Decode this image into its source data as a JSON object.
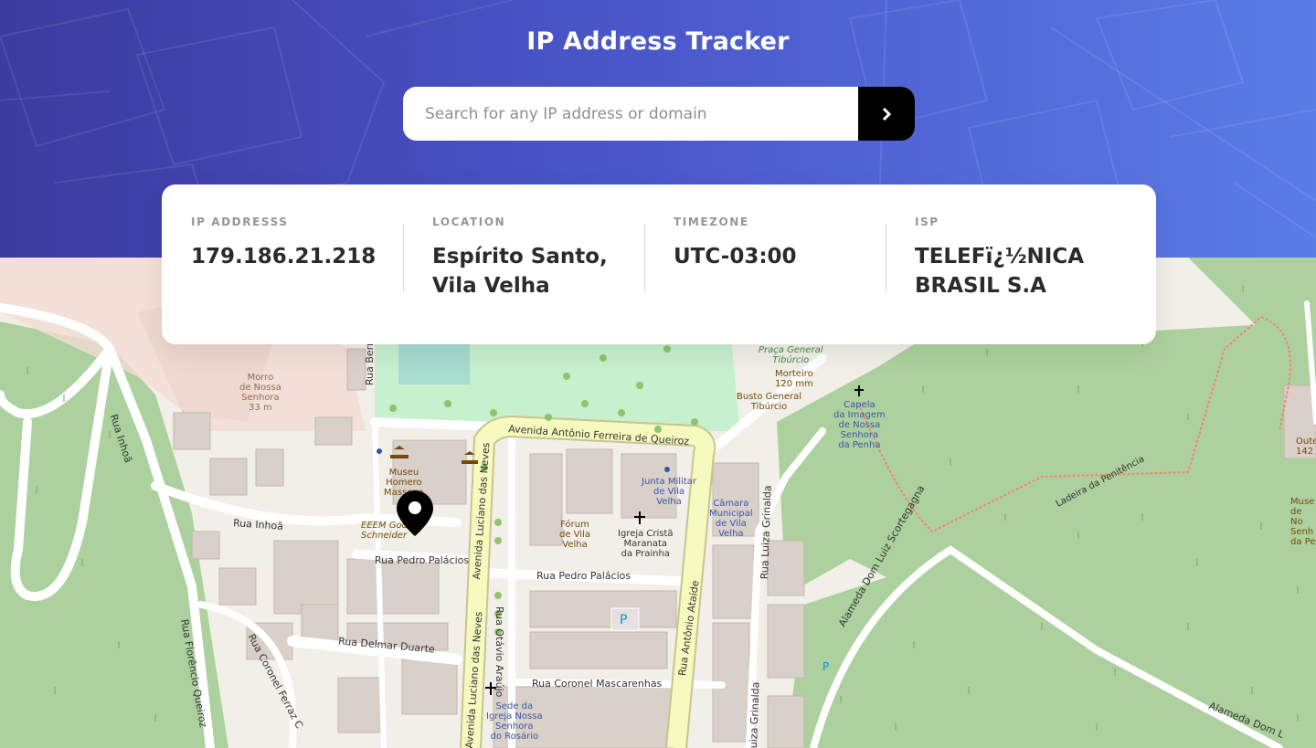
{
  "app": {
    "title": "IP Address Tracker"
  },
  "search": {
    "placeholder": "Search for any IP address or domain",
    "value": "",
    "submit_icon": "chevron-right-icon"
  },
  "info": {
    "ip": {
      "label": "IP ADDRESSS",
      "value": "179.186.21.218"
    },
    "location": {
      "label": "LOCATION",
      "value": "Espírito Santo, Vila Velha"
    },
    "timezone": {
      "label": "TIMEZONE",
      "value": "UTC-03:00"
    },
    "isp": {
      "label": "ISP",
      "value": "TELEFï¿½NICA BRASIL S.A"
    }
  },
  "map": {
    "marker_icon": "location-pin-icon",
    "labels": {
      "morro": "Morro\nde Nossa\nSenhora\n33 m",
      "rua_inhoa": "Rua Inhoã",
      "rua_inhoa_v": "Rua Inhoã",
      "rua_florencio": "Rua Florêncio Queiroz",
      "rua_coronel_ferraz": "Rua Coronel Ferraz C",
      "rua_delmar": "Rua Delmar Duarte",
      "rua_pedro1": "Rua Pedro Palácios",
      "rua_pedro2": "Rua Pedro Palácios",
      "av_luciano": "Avenida Luciano das Neves",
      "av_luciano2": "Avenida Luciano das Neves",
      "av_antonio": "Avenida Antônio Ferreira de Queiroz",
      "rua_ataide": "Rua Antônio Ataíde",
      "rua_otavio": "Rua Otávio Araújo",
      "rua_mascarenhas": "Rua Coronel Mascarenhas",
      "rua_grinalda": "Rua Luiza Grinalda",
      "rua_grinalda2": "uiza Grinalda",
      "alameda": "Alameda Dom Luiz Scortegagna",
      "alameda2": "Alameda Dom L",
      "ladeira": "Ladeira da Penitência",
      "museu": "Museu\nHomero\nMassena",
      "eeem": "EEEM Godo\nSchneider",
      "forum": "Fórum\nde Vila\nVelha",
      "igreja": "Igreja Cristã\nMaranata\nda Prainha",
      "junta": "Junta Militar\nde Vila\nVelha",
      "camara": "Câmara\nMunicipal\nde Vila\nVelha",
      "sede": "Sede da\nIgreja Nossa\nSenhora\ndo Rosário",
      "praca": "Praça General\nTibúrcio",
      "morteiro": "Morteiro\n120 mm",
      "busto": "Busto General\nTibúrcio",
      "capela": "Capela\nda Imagem\nde Nossa\nSenhora\nda Penha",
      "rua_bern": "Rua Bern",
      "oute": "Oute\n142",
      "musei": "Muse\nde No\nSenh\nda Pe"
    }
  },
  "colors": {
    "header_start": "#3c3a9e",
    "header_end": "#5a7ce6",
    "text_dark": "#2b2b2b",
    "label_gray": "#969696",
    "button_bg": "#000000",
    "map_green": "#add19e",
    "map_road_yellow": "#f7fabf"
  }
}
